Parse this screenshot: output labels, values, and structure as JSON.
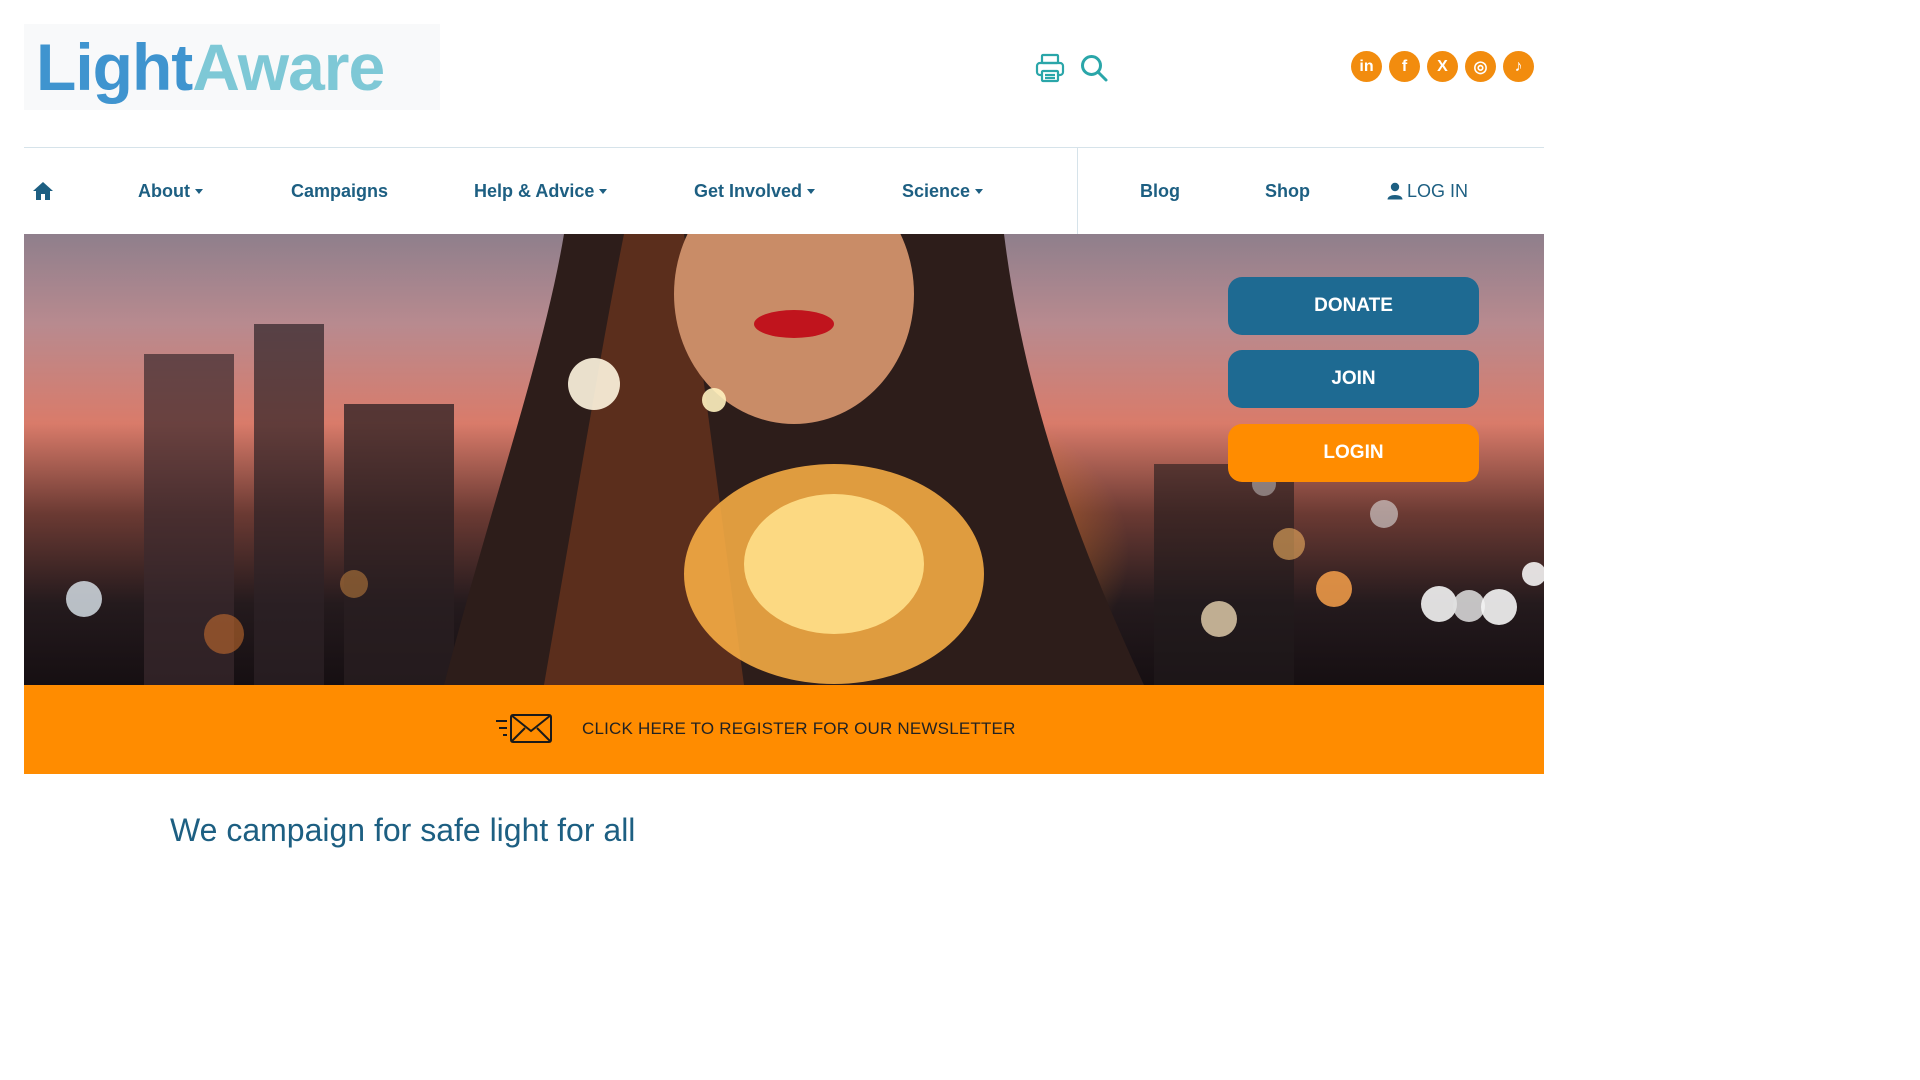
{
  "header": {
    "logo_part1": "Light",
    "logo_part2": "Aware",
    "tools": [
      "printer-icon",
      "search-icon"
    ],
    "social": [
      {
        "name": "linkedin-icon",
        "glyph": "in"
      },
      {
        "name": "facebook-icon",
        "glyph": "f"
      },
      {
        "name": "x-icon",
        "glyph": "X"
      },
      {
        "name": "instagram-icon",
        "glyph": "◎"
      },
      {
        "name": "tiktok-icon",
        "glyph": "♪"
      }
    ]
  },
  "nav": {
    "home_icon": "home-icon",
    "items": [
      {
        "label": "About",
        "dropdown": true
      },
      {
        "label": "Campaigns",
        "dropdown": false
      },
      {
        "label": "Help & Advice",
        "dropdown": true
      },
      {
        "label": "Get Involved",
        "dropdown": true
      },
      {
        "label": "Science",
        "dropdown": true
      }
    ],
    "right_items": [
      {
        "label": "Blog"
      },
      {
        "label": "Shop"
      }
    ],
    "login_label": "LOG IN"
  },
  "hero": {
    "donate_label": "DONATE",
    "join_label": "JOIN",
    "login_label": "LOGIN"
  },
  "newsletter": {
    "text": "CLICK HERE TO REGISTER FOR OUR NEWSLETTER"
  },
  "main": {
    "tagline": "We campaign for safe light for all"
  },
  "colors": {
    "brand_blue": "#1d5f82",
    "button_blue": "#1e6a92",
    "accent_orange": "#ff8c00",
    "logo_blue": "#3f94cf",
    "logo_teal": "#7ec8d6"
  }
}
